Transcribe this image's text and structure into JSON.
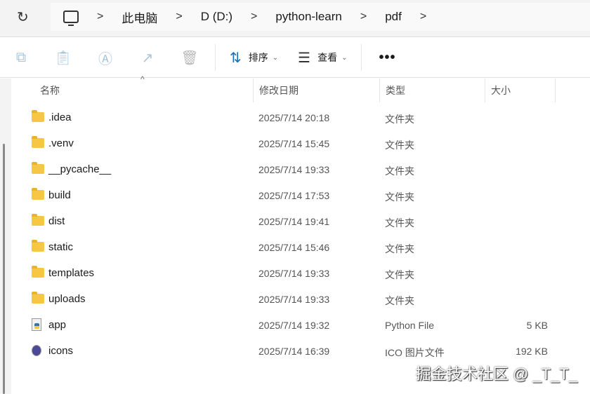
{
  "breadcrumb": [
    "此电脑",
    "D (D:)",
    "python-learn",
    "pdf"
  ],
  "toolbar": {
    "sort_label": "排序",
    "view_label": "查看",
    "more_label": "•••"
  },
  "columns": {
    "name": "名称",
    "date": "修改日期",
    "type": "类型",
    "size": "大小"
  },
  "files": [
    {
      "name": ".idea",
      "date": "2025/7/14 20:18",
      "type": "文件夹",
      "size": "",
      "icon": "folder"
    },
    {
      "name": ".venv",
      "date": "2025/7/14 15:45",
      "type": "文件夹",
      "size": "",
      "icon": "folder"
    },
    {
      "name": "__pycache__",
      "date": "2025/7/14 19:33",
      "type": "文件夹",
      "size": "",
      "icon": "folder"
    },
    {
      "name": "build",
      "date": "2025/7/14 17:53",
      "type": "文件夹",
      "size": "",
      "icon": "folder"
    },
    {
      "name": "dist",
      "date": "2025/7/14 19:41",
      "type": "文件夹",
      "size": "",
      "icon": "folder"
    },
    {
      "name": "static",
      "date": "2025/7/14 15:46",
      "type": "文件夹",
      "size": "",
      "icon": "folder"
    },
    {
      "name": "templates",
      "date": "2025/7/14 19:33",
      "type": "文件夹",
      "size": "",
      "icon": "folder"
    },
    {
      "name": "uploads",
      "date": "2025/7/14 19:33",
      "type": "文件夹",
      "size": "",
      "icon": "folder"
    },
    {
      "name": "app",
      "date": "2025/7/14 19:32",
      "type": "Python File",
      "size": "5 KB",
      "icon": "python-file"
    },
    {
      "name": "icons",
      "date": "2025/7/14 16:39",
      "type": "ICO 图片文件",
      "size": "192 KB",
      "icon": "ico-file"
    }
  ],
  "watermark": "掘金技术社区 @ _T_T_"
}
